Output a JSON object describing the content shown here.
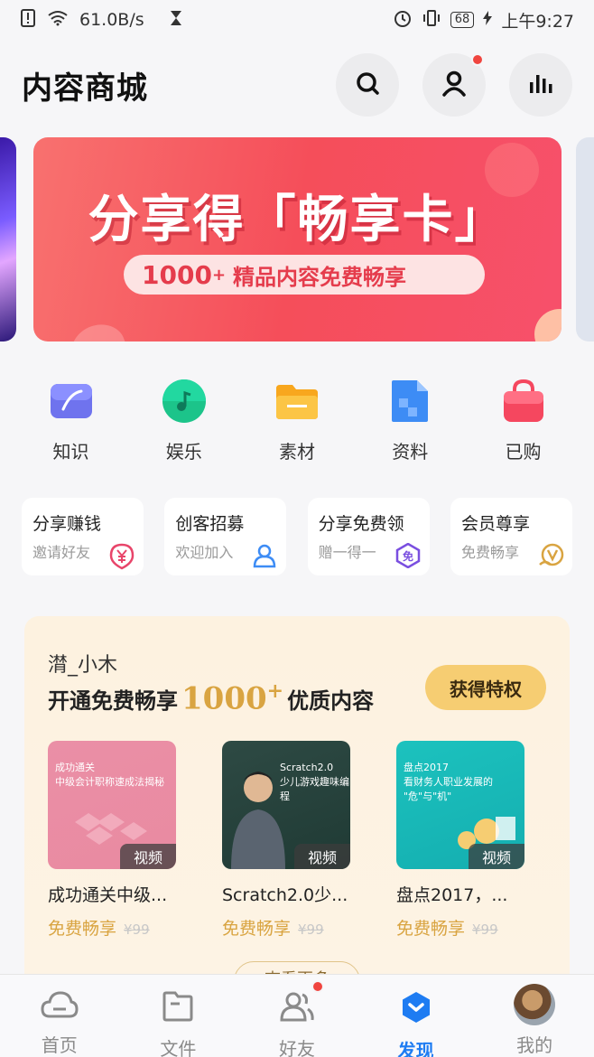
{
  "status_bar": {
    "speed": "61.0B/s",
    "battery": "68",
    "time": "上午9:27"
  },
  "header": {
    "title": "内容商城"
  },
  "banner": {
    "title": "分享得「畅享卡」",
    "pill_number": "1000",
    "pill_plus": "+",
    "pill_text": "精品内容免费畅享"
  },
  "categories": [
    {
      "label": "知识",
      "icon": "knowledge-icon",
      "color": "#6f73ee"
    },
    {
      "label": "娱乐",
      "icon": "music-icon",
      "color": "#1cc48a"
    },
    {
      "label": "素材",
      "icon": "folder-icon",
      "color": "#f8b42e"
    },
    {
      "label": "资料",
      "icon": "document-icon",
      "color": "#3d8cf5"
    },
    {
      "label": "已购",
      "icon": "bag-icon",
      "color": "#f5475f"
    }
  ],
  "cards": [
    {
      "title": "分享赚钱",
      "sub": "邀请好友",
      "icon": "yuan-icon",
      "color": "#e8456a"
    },
    {
      "title": "创客招募",
      "sub": "欢迎加入",
      "icon": "person-icon",
      "color": "#3d8cf5"
    },
    {
      "title": "分享免费领",
      "sub": "赠一得一",
      "icon": "free-icon",
      "color": "#7a4fe0"
    },
    {
      "title": "会员尊享",
      "sub": "免费畅享",
      "icon": "vip-icon",
      "color": "#d9a441"
    }
  ],
  "vip": {
    "username": "潸_小木",
    "slogan_prefix": "开通免费畅享",
    "slogan_number": "1000",
    "slogan_plus": "+",
    "slogan_suffix": "优质内容",
    "button": "获得特权",
    "more": "查看更多"
  },
  "products": [
    {
      "name": "成功通关中级...",
      "tag": "视频",
      "free": "免费畅享",
      "old": "¥99",
      "thumb_text": "成功通关\n中级会计职称速成法揭秘"
    },
    {
      "name": "Scratch2.0少...",
      "tag": "视频",
      "free": "免费畅享",
      "old": "¥99",
      "thumb_text": "Scratch2.0\n少儿游戏趣味编程"
    },
    {
      "name": "盘点2017，...",
      "tag": "视频",
      "free": "免费畅享",
      "old": "¥99",
      "thumb_text": "盘点2017\n看财务人职业发展的\n\"危\"与\"机\""
    }
  ],
  "tabbar": [
    {
      "label": "首页",
      "icon": "cloud-icon",
      "active": false
    },
    {
      "label": "文件",
      "icon": "file-icon",
      "active": false
    },
    {
      "label": "好友",
      "icon": "friends-icon",
      "active": false
    },
    {
      "label": "发现",
      "icon": "discover-icon",
      "active": true
    },
    {
      "label": "我的",
      "icon": "avatar-icon",
      "active": false
    }
  ],
  "colors": {
    "accent": "#1e7cf2",
    "gold": "#d9a441",
    "banner": "#f54e5a"
  }
}
